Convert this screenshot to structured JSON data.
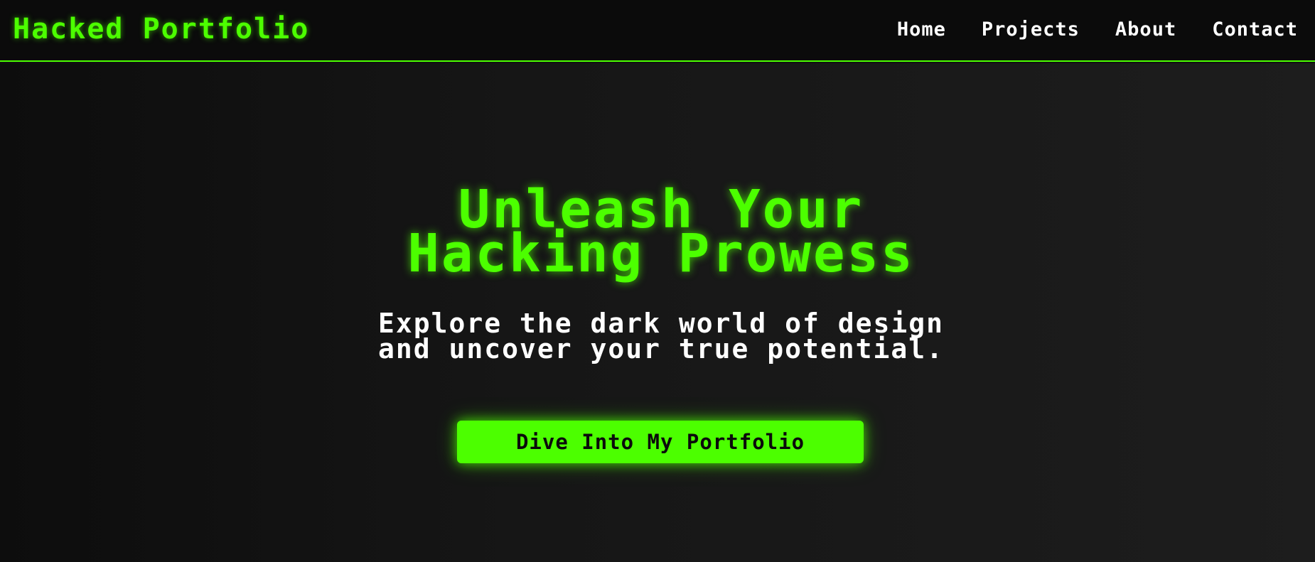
{
  "header": {
    "brand": "Hacked Portfolio",
    "nav": [
      {
        "label": "Home"
      },
      {
        "label": "Projects"
      },
      {
        "label": "About"
      },
      {
        "label": "Contact"
      }
    ]
  },
  "hero": {
    "title_line1": "Unleash Your",
    "title_line2": "Hacking Prowess",
    "subtitle_line1": "Explore the dark world of design",
    "subtitle_line2": "and uncover your true potential.",
    "cta_label": "Dive Into My Portfolio"
  },
  "colors": {
    "accent": "#4cff00",
    "background": "#111111",
    "header_background": "#0b0b0b",
    "text": "#ffffff"
  }
}
